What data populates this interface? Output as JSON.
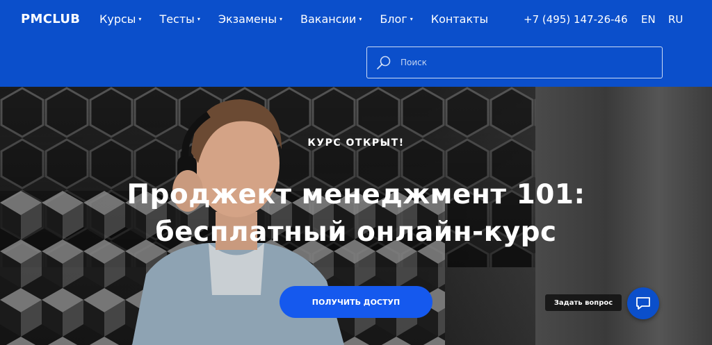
{
  "header": {
    "logo": "PMCLUB",
    "nav": [
      {
        "label": "Курсы",
        "caret": true
      },
      {
        "label": "Тесты",
        "caret": true
      },
      {
        "label": "Экзамены",
        "caret": true
      },
      {
        "label": "Вакансии",
        "caret": true
      },
      {
        "label": "Блог",
        "caret": true
      },
      {
        "label": "Контакты",
        "caret": false
      }
    ],
    "phone": "+7 (495) 147-26-46",
    "lang_en": "EN",
    "lang_ru": "RU",
    "caret_glyph": "▾"
  },
  "search": {
    "placeholder": "Поиск",
    "value": "",
    "icon": "search-icon"
  },
  "hero": {
    "kicker": "КУРС ОТКРЫТ!",
    "title_line1": "Проджект менеджмент 101:",
    "title_line2": "бесплатный онлайн-курс",
    "cta_label": "ПОЛУЧИТЬ ДОСТУП"
  },
  "chat": {
    "label": "Задать вопрос",
    "icon": "chat-bubble-icon"
  },
  "colors": {
    "header_bg": "#0b4fcb",
    "cta_bg": "#1559ee",
    "text": "#ffffff"
  }
}
